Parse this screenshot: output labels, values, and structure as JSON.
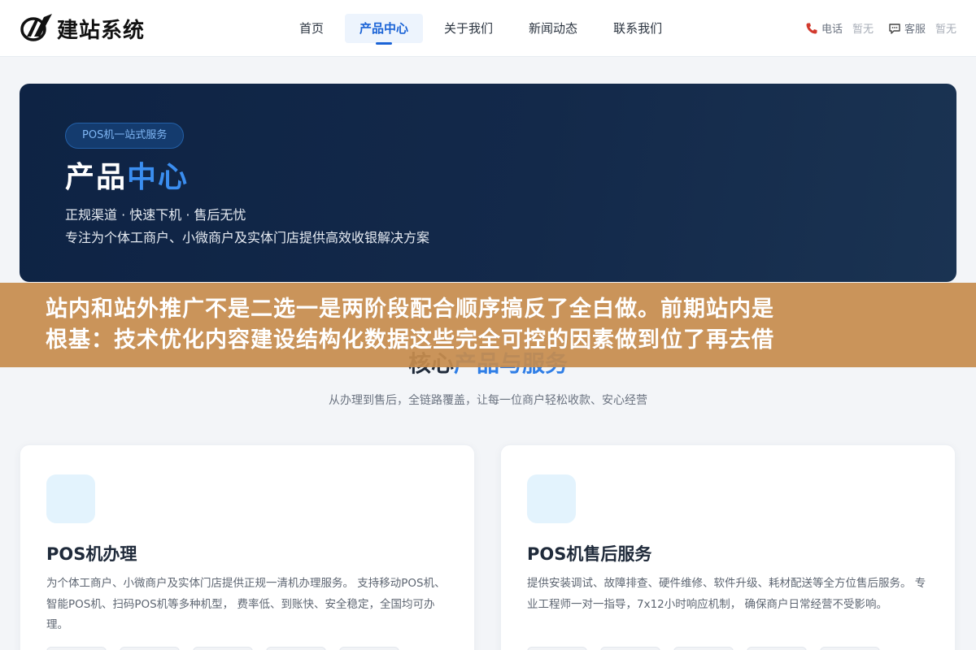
{
  "header": {
    "logo_text": "建站系统",
    "nav": [
      {
        "label": "首页",
        "active": false
      },
      {
        "label": "产品中心",
        "active": true
      },
      {
        "label": "关于我们",
        "active": false
      },
      {
        "label": "新闻动态",
        "active": false
      },
      {
        "label": "联系我们",
        "active": false
      }
    ],
    "phone": {
      "icon": "phone-icon",
      "label": "电话",
      "value": "暂无"
    },
    "service": {
      "icon": "chat-icon",
      "label": "客服",
      "value": "暂无"
    }
  },
  "hero": {
    "badge": "POS机一站式服务",
    "title_main": "产品",
    "title_accent": "中心",
    "line1": "正规渠道 · 快速下机 · 售后无忧",
    "line2": "专注为个体工商户、小微商户及实体门店提供高效收银解决方案"
  },
  "overlay": {
    "line1": "站内和站外推广不是二选一是两阶段配合顺序搞反了全白做。前期站内是",
    "line2": "根基：技术优化内容建设结构化数据这些完全可控的因素做到位了再去借"
  },
  "section": {
    "title_main": "核心",
    "title_accent": "产品与服务",
    "subtitle": "从办理到售后，全链路覆盖，让每一位商户轻松收款、安心经营"
  },
  "cards": [
    {
      "title": "POS机办理",
      "desc": "为个体工商户、小微商户及实体门店提供正规一清机办理服务。 支持移动POS机、智能POS机、扫码POS机等多种机型， 费率低、到账快、安全稳定，全国均可办理。"
    },
    {
      "title": "POS机售后服务",
      "desc": "提供安装调试、故障排查、硬件维修、软件升级、耗材配送等全方位售后服务。 专业工程师一对一指导，7x12小时响应机制， 确保商户日常经营不受影响。"
    }
  ],
  "colors": {
    "accent": "#1a63d6",
    "hero_bg": "#0e2344",
    "overlay": "#c68c4e"
  }
}
